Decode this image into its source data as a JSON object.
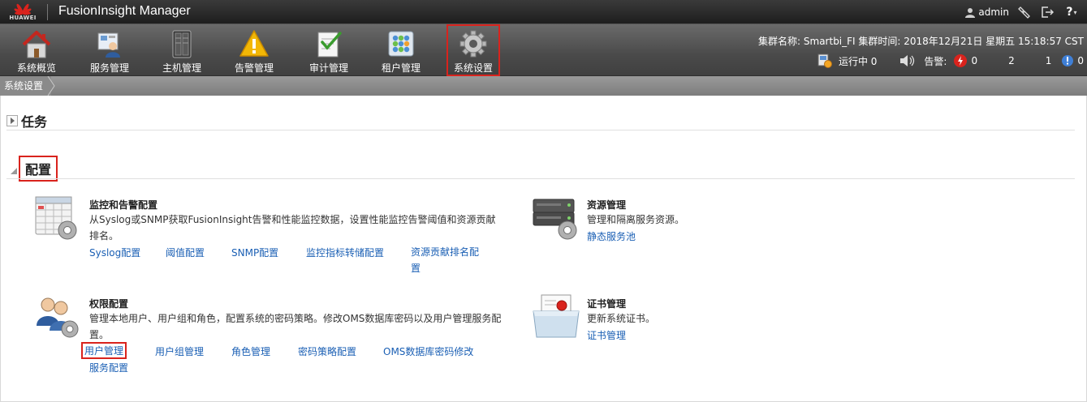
{
  "header": {
    "brand": "HUAWEI",
    "app_title": "FusionInsight Manager",
    "user": "admin",
    "help_label": "?"
  },
  "nav": {
    "items": [
      {
        "label": "系统概览",
        "icon": "home-icon"
      },
      {
        "label": "服务管理",
        "icon": "service-management-icon"
      },
      {
        "label": "主机管理",
        "icon": "server-rack-icon"
      },
      {
        "label": "告警管理",
        "icon": "warning-icon"
      },
      {
        "label": "审计管理",
        "icon": "audit-checklist-icon"
      },
      {
        "label": "租户管理",
        "icon": "tenant-grid-icon"
      },
      {
        "label": "系统设置",
        "icon": "gear-icon",
        "active": true
      }
    ],
    "cluster_info": "集群名称: Smartbi_FI   集群时间: 2018年12月21日 星期五 15:18:57 CST",
    "running_label": "运行中 0",
    "alarm_label": "告警:",
    "alarm_critical": "0",
    "alarm_major": "2",
    "alarm_minor": "1",
    "alarm_warning": "0"
  },
  "breadcrumb": {
    "current": "系统设置"
  },
  "sections": {
    "tasks_title": "任务",
    "config_title": "配置"
  },
  "cards": {
    "monitor": {
      "title": "监控和告警配置",
      "desc": "从Syslog或SNMP获取FusionInsight告警和性能监控数据，设置性能监控告警阈值和资源贡献排名。",
      "links": [
        "Syslog配置",
        "阈值配置",
        "SNMP配置",
        "监控指标转储配置",
        "资源贡献排名配置"
      ]
    },
    "resource": {
      "title": "资源管理",
      "desc": "管理和隔离服务资源。",
      "links": [
        "静态服务池"
      ]
    },
    "permission": {
      "title": "权限配置",
      "desc": "管理本地用户、用户组和角色，配置系统的密码策略。修改OMS数据库密码以及用户管理服务配置。",
      "links": [
        "用户管理",
        "用户组管理",
        "角色管理",
        "密码策略配置",
        "OMS数据库密码修改",
        "服务配置"
      ]
    },
    "cert": {
      "title": "证书管理",
      "desc": "更新系统证书。",
      "links": [
        "证书管理"
      ]
    }
  },
  "colors": {
    "accent_red": "#d9231d",
    "link_blue": "#1a5fb4"
  }
}
